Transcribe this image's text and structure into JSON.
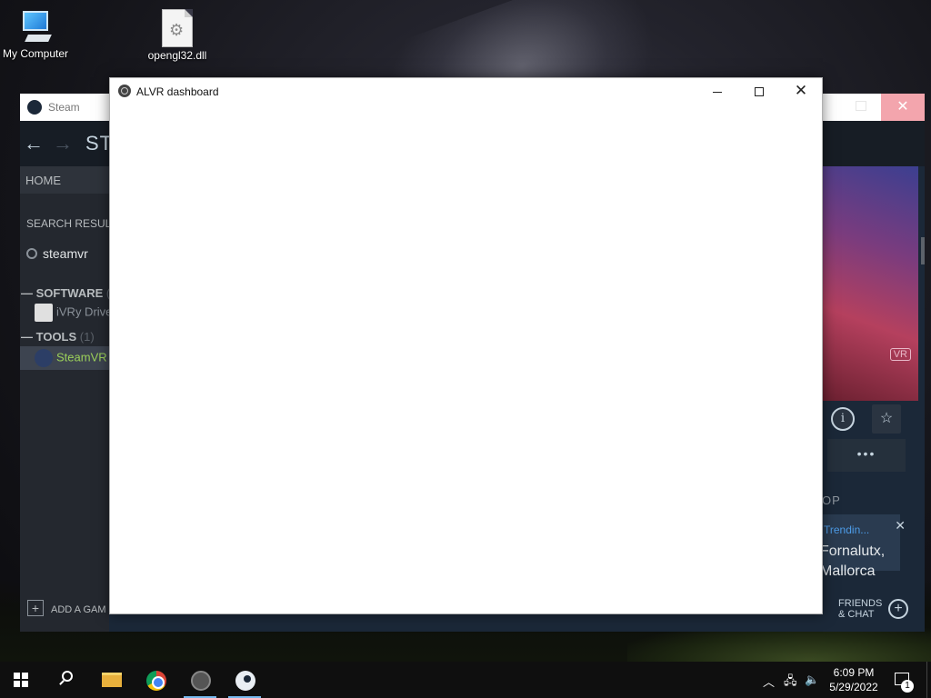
{
  "desktop": {
    "icons": [
      {
        "label": "My Computer"
      },
      {
        "label": "opengl32.dll"
      }
    ]
  },
  "steam": {
    "title": "Steam",
    "nav_title": "ST",
    "sidebar": {
      "home": "HOME",
      "search_results": "SEARCH RESUL",
      "search_value": "steamvr",
      "categories": [
        {
          "name": "SOFTWARE",
          "count": "(",
          "items": [
            {
              "label": "iVRy Drive"
            }
          ]
        },
        {
          "name": "TOOLS",
          "count": "(1)",
          "items": [
            {
              "label": "SteamVR",
              "selected": true
            }
          ]
        }
      ],
      "add_game": "ADD A GAM"
    },
    "right": {
      "vr_badge": "VR",
      "info_icon": "i",
      "star_icon": "☆",
      "more": "•••",
      "shop_label": "OP",
      "trending_tag": "Trendin...",
      "trending_title_1": "Fornalutx,",
      "trending_title_2": "Mallorca",
      "friends_line1": "FRIENDS",
      "friends_line2": "& CHAT"
    }
  },
  "alvr": {
    "title": "ALVR dashboard"
  },
  "taskbar": {
    "time": "6:09 PM",
    "date": "5/29/2022",
    "notification_count": "1"
  },
  "colors": {
    "steam_selected_text": "#9bd05a",
    "taskbar_active": "#76b9ed",
    "steam_close": "#f3a5ad"
  }
}
